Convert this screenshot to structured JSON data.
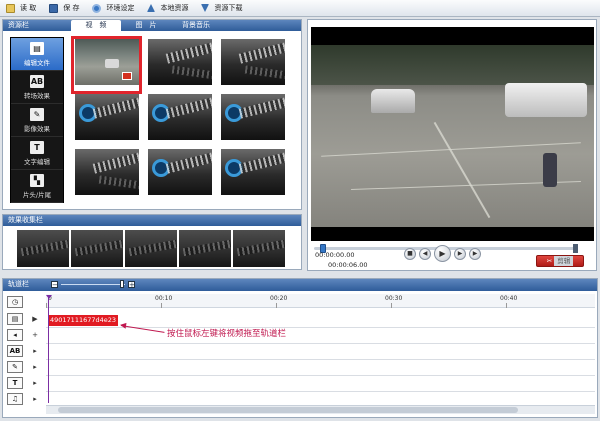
{
  "toolbar": {
    "items": [
      {
        "label": "读 取",
        "icon": "folder-open-icon"
      },
      {
        "label": "保 存",
        "icon": "save-icon"
      },
      {
        "label": "环境设定",
        "icon": "gear-icon"
      },
      {
        "label": "本地资源",
        "icon": "upload-icon"
      },
      {
        "label": "资源下载",
        "icon": "download-icon"
      }
    ]
  },
  "resource_panel": {
    "title": "资源栏",
    "tabs": [
      "视　频",
      "图　片",
      "背景音乐"
    ],
    "active_tab": 0,
    "categories": [
      {
        "label": "编辑文件",
        "icon": "film-icon",
        "glyph": "▤"
      },
      {
        "label": "转场效果",
        "icon": "transition-icon",
        "glyph": "AB"
      },
      {
        "label": "影像效果",
        "icon": "image-effect-icon",
        "glyph": "✎"
      },
      {
        "label": "文字编辑",
        "icon": "text-icon",
        "glyph": "T"
      },
      {
        "label": "片头/片尾",
        "icon": "intro-outro-icon",
        "glyph": "▚"
      }
    ],
    "active_category": 0
  },
  "effects_panel": {
    "title": "效果收集栏"
  },
  "preview": {
    "time_current": "00:00:00.00",
    "time_total": "00:00:06.00",
    "controls": [
      "stop",
      "prev-frame",
      "play",
      "next-frame",
      "end"
    ],
    "cut_label": "剪辑"
  },
  "track_panel": {
    "title": "轨道栏",
    "ruler_labels": [
      "0",
      "00:10",
      "00:20",
      "00:30",
      "00:40"
    ],
    "rows": [
      {
        "icon": "clock-icon",
        "glyph": "◷",
        "control": ""
      },
      {
        "icon": "film-track-icon",
        "glyph": "▤",
        "control": "▶"
      },
      {
        "icon": "audio-track-icon",
        "glyph": "◂",
        "control": "+"
      },
      {
        "icon": "transition-track-icon",
        "glyph": "AB",
        "control": "▸"
      },
      {
        "icon": "effect-track-icon",
        "glyph": "✎",
        "control": "▸"
      },
      {
        "icon": "text-track-icon",
        "glyph": "T",
        "control": "▸"
      },
      {
        "icon": "music-track-icon",
        "glyph": "♫",
        "control": "▸"
      }
    ],
    "clip_label": "49017111677d4e23",
    "hint": "按住鼠标左键将视频拖至轨道栏"
  },
  "colors": {
    "accent": "#2f5c99",
    "clip": "#e11b22",
    "hint": "#c0184f",
    "selection": "#e0242c"
  }
}
